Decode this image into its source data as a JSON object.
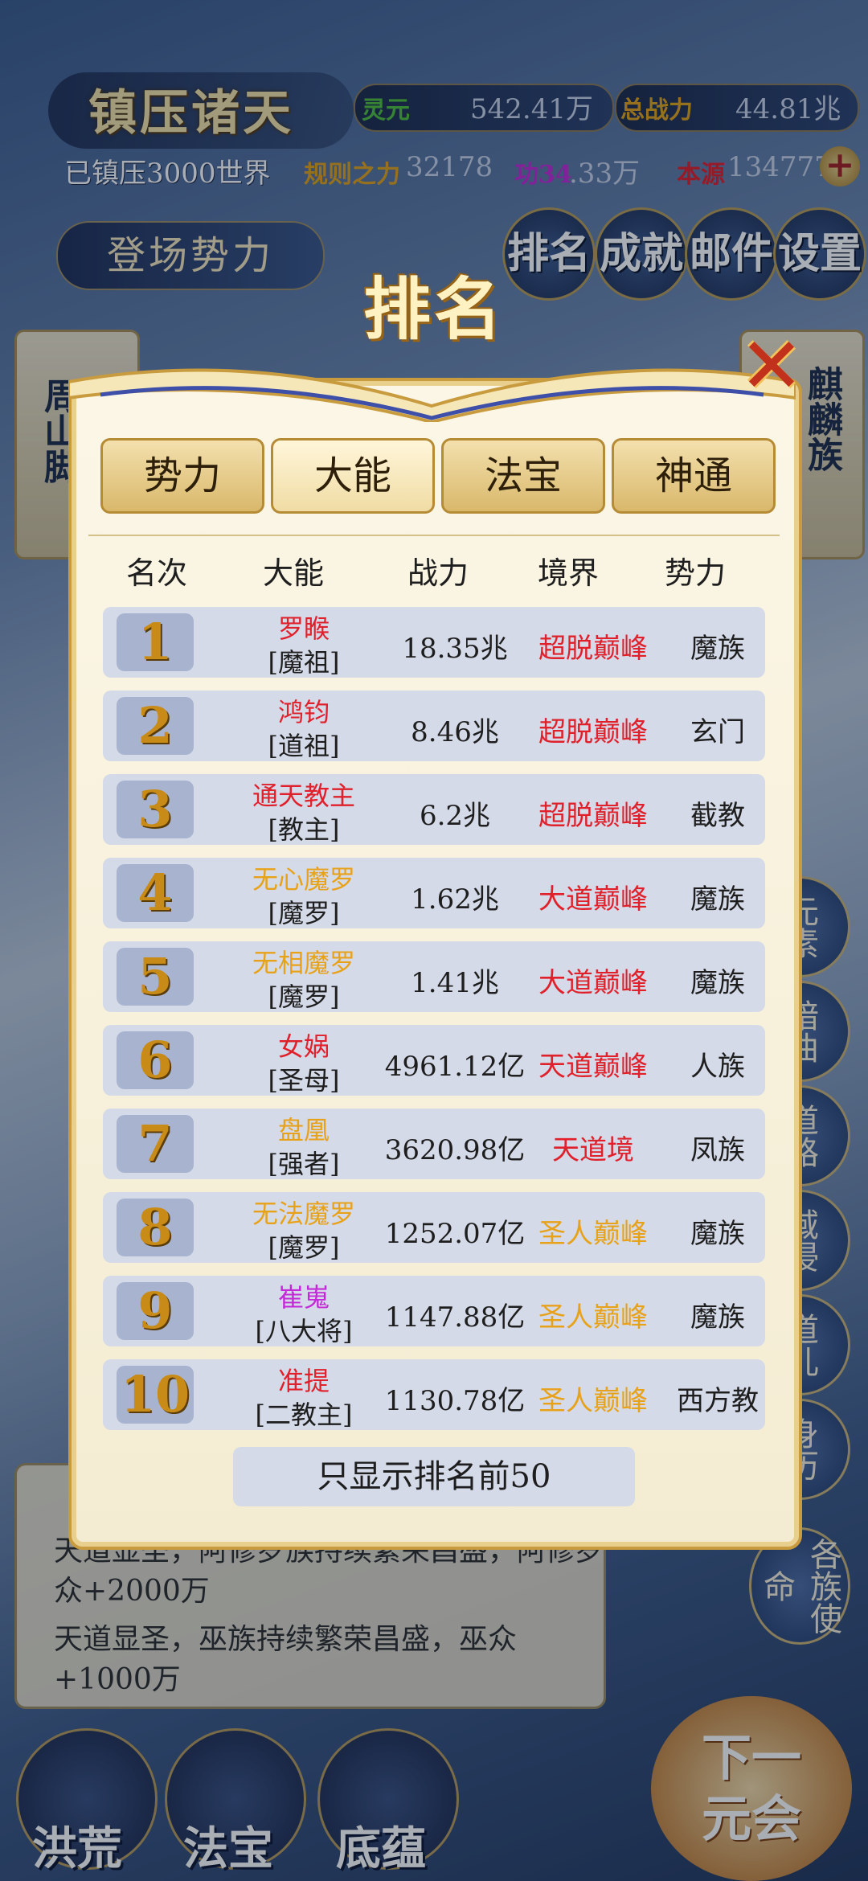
{
  "hud": {
    "title": "镇压诸天",
    "lingyuan_label": "灵元",
    "lingyuan_value": "542.41万",
    "zhanli_label": "总战力",
    "zhanli_value": "44.81兆",
    "suppressed": "已镇压3000世界",
    "guize_label": "规则之力",
    "guize_value": "32178",
    "gong_label": "功34",
    "gong_value": ".33万",
    "benyuan_label": "本源",
    "benyuan_value": "134777",
    "enter_label": "登场势力",
    "buttons": [
      "排名",
      "成就",
      "邮件",
      "设置"
    ]
  },
  "background": {
    "left_card_text": "周山脚",
    "right_card_text": "麒麟族",
    "side_badges": [
      "元素",
      "暗曲",
      "道路",
      "域侵",
      "道儿",
      "身历",
      "各族使命"
    ],
    "log_lines": [
      "天道显圣，阿修罗族持续繁荣昌盛，阿修罗众+2000万",
      "天道显圣，巫族持续繁荣昌盛，巫众+1000万"
    ],
    "bottom_buttons": [
      "洪荒",
      "法宝",
      "底蕴"
    ],
    "next_label_1": "下一",
    "next_label_2": "元会"
  },
  "modal": {
    "title": "排名",
    "tabs": [
      "势力",
      "大能",
      "法宝",
      "神通"
    ],
    "active_tab": "大能",
    "columns": [
      "名次",
      "大能",
      "战力",
      "境界",
      "势力"
    ],
    "rows": [
      {
        "rank": "1",
        "name": "罗睺",
        "title": "[魔祖]",
        "power": "18.35兆",
        "realm": "超脱巅峰",
        "faction": "魔族",
        "name_color": "#e0202a",
        "realm_color": "#e0202a"
      },
      {
        "rank": "2",
        "name": "鸿钧",
        "title": "[道祖]",
        "power": "8.46兆",
        "realm": "超脱巅峰",
        "faction": "玄门",
        "name_color": "#e0202a",
        "realm_color": "#e0202a"
      },
      {
        "rank": "3",
        "name": "通天教主",
        "title": "[教主]",
        "power": "6.2兆",
        "realm": "超脱巅峰",
        "faction": "截教",
        "name_color": "#e0202a",
        "realm_color": "#e0202a"
      },
      {
        "rank": "4",
        "name": "无心魔罗",
        "title": "[魔罗]",
        "power": "1.62兆",
        "realm": "大道巅峰",
        "faction": "魔族",
        "name_color": "#e8a21a",
        "realm_color": "#e0202a"
      },
      {
        "rank": "5",
        "name": "无相魔罗",
        "title": "[魔罗]",
        "power": "1.41兆",
        "realm": "大道巅峰",
        "faction": "魔族",
        "name_color": "#e8a21a",
        "realm_color": "#e0202a"
      },
      {
        "rank": "6",
        "name": "女娲",
        "title": "[圣母]",
        "power": "4961.12亿",
        "realm": "天道巅峰",
        "faction": "人族",
        "name_color": "#e0202a",
        "realm_color": "#e0202a"
      },
      {
        "rank": "7",
        "name": "盘凰",
        "title": "[强者]",
        "power": "3620.98亿",
        "realm": "天道境",
        "faction": "凤族",
        "name_color": "#e8a21a",
        "realm_color": "#e0202a"
      },
      {
        "rank": "8",
        "name": "无法魔罗",
        "title": "[魔罗]",
        "power": "1252.07亿",
        "realm": "圣人巅峰",
        "faction": "魔族",
        "name_color": "#e8a21a",
        "realm_color": "#e8a21a"
      },
      {
        "rank": "9",
        "name": "崔嵬",
        "title": "[八大将]",
        "power": "1147.88亿",
        "realm": "圣人巅峰",
        "faction": "魔族",
        "name_color": "#c428d8",
        "realm_color": "#e8a21a"
      },
      {
        "rank": "10",
        "name": "准提",
        "title": "[二教主]",
        "power": "1130.78亿",
        "realm": "圣人巅峰",
        "faction": "西方教",
        "name_color": "#e0202a",
        "realm_color": "#e8a21a"
      }
    ],
    "footer": "只显示排名前50"
  }
}
